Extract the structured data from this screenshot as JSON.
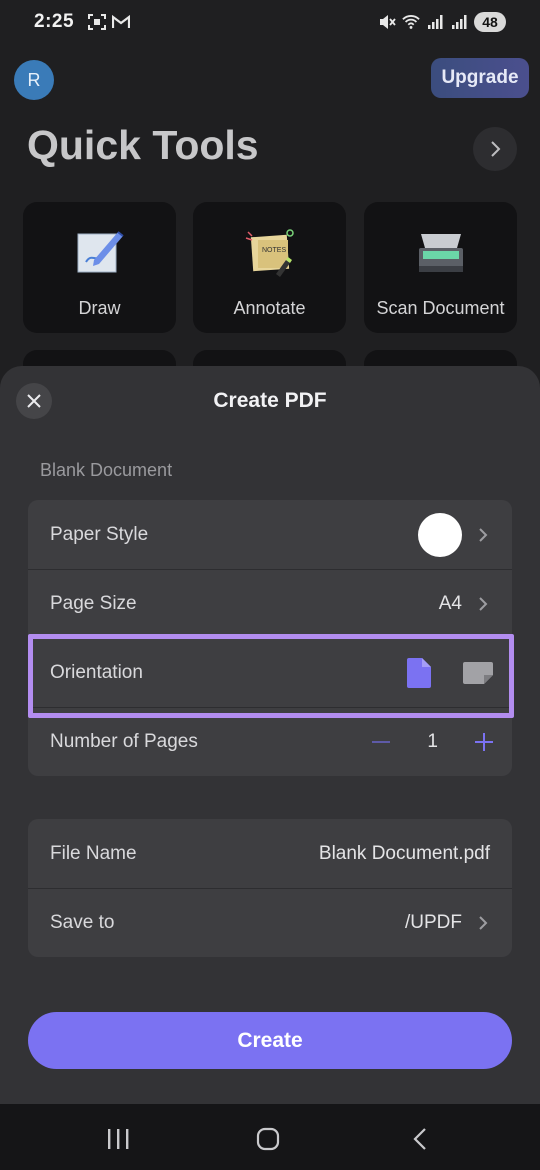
{
  "status_bar": {
    "time": "2:25",
    "battery": "48"
  },
  "home": {
    "avatar_initial": "R",
    "upgrade_label": "Upgrade",
    "quick_tools_title": "Quick Tools",
    "tools": [
      {
        "label": "Draw",
        "icon": "draw-icon"
      },
      {
        "label": "Annotate",
        "icon": "annotate-icon"
      },
      {
        "label": "Scan Document",
        "icon": "scanner-icon"
      }
    ]
  },
  "sheet": {
    "title": "Create PDF",
    "section_label": "Blank Document",
    "paper_style_label": "Paper Style",
    "page_size_label": "Page Size",
    "page_size_value": "A4",
    "orientation_label": "Orientation",
    "orientation_selected": "portrait",
    "number_of_pages_label": "Number of Pages",
    "number_of_pages_value": "1",
    "file_name_label": "File Name",
    "file_name_value": "Blank Document.pdf",
    "save_to_label": "Save to",
    "save_to_value": "/UPDF",
    "create_label": "Create"
  },
  "colors": {
    "accent": "#7b72f2",
    "highlight": "#b38df0",
    "sheet_bg": "#333336",
    "row_bg": "#3e3e41"
  }
}
